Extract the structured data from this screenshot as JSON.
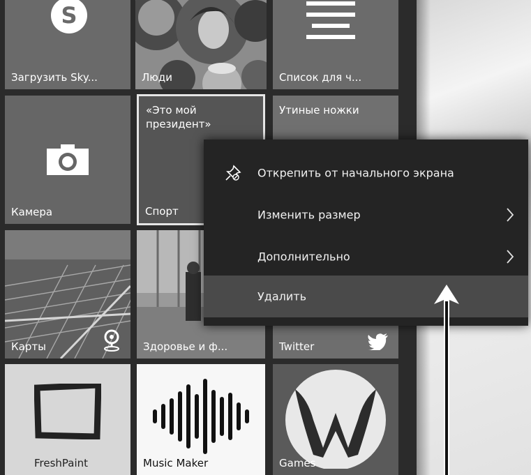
{
  "tiles": {
    "skype": {
      "label": "Загрузить Sky...",
      "icon": "skype-icon"
    },
    "people": {
      "label": "Люди"
    },
    "reading_list": {
      "label": "Список для ч...",
      "icon": "reading-list-icon"
    },
    "camera": {
      "label": "Камера",
      "icon": "camera-icon"
    },
    "sport": {
      "headline": "«Это мой президент»",
      "label": "Спорт"
    },
    "duck_feet": {
      "label": "Утиные ножки"
    },
    "maps": {
      "label": "Карты",
      "icon": "map-pin-icon"
    },
    "health": {
      "label": "Здоровье и ф..."
    },
    "twitter": {
      "label": "Twitter",
      "icon": "twitter-bird-icon"
    },
    "fresh_paint": {
      "label": "FreshPaint",
      "icon": "frame-icon"
    },
    "music_maker": {
      "label": "Music Maker",
      "icon": "waveform-icon"
    },
    "games": {
      "label": "Games",
      "icon": "w-logo-icon"
    }
  },
  "context_menu": {
    "items": [
      {
        "label": "Открепить от начального экрана",
        "icon": "unpin-icon",
        "submenu": false
      },
      {
        "label": "Изменить размер",
        "submenu": true
      },
      {
        "label": "Дополнительно",
        "submenu": true
      },
      {
        "label": "Удалить",
        "submenu": false,
        "highlighted": true
      }
    ]
  },
  "annotation": {
    "icon": "up-arrow-icon",
    "color": "#ffffff"
  }
}
